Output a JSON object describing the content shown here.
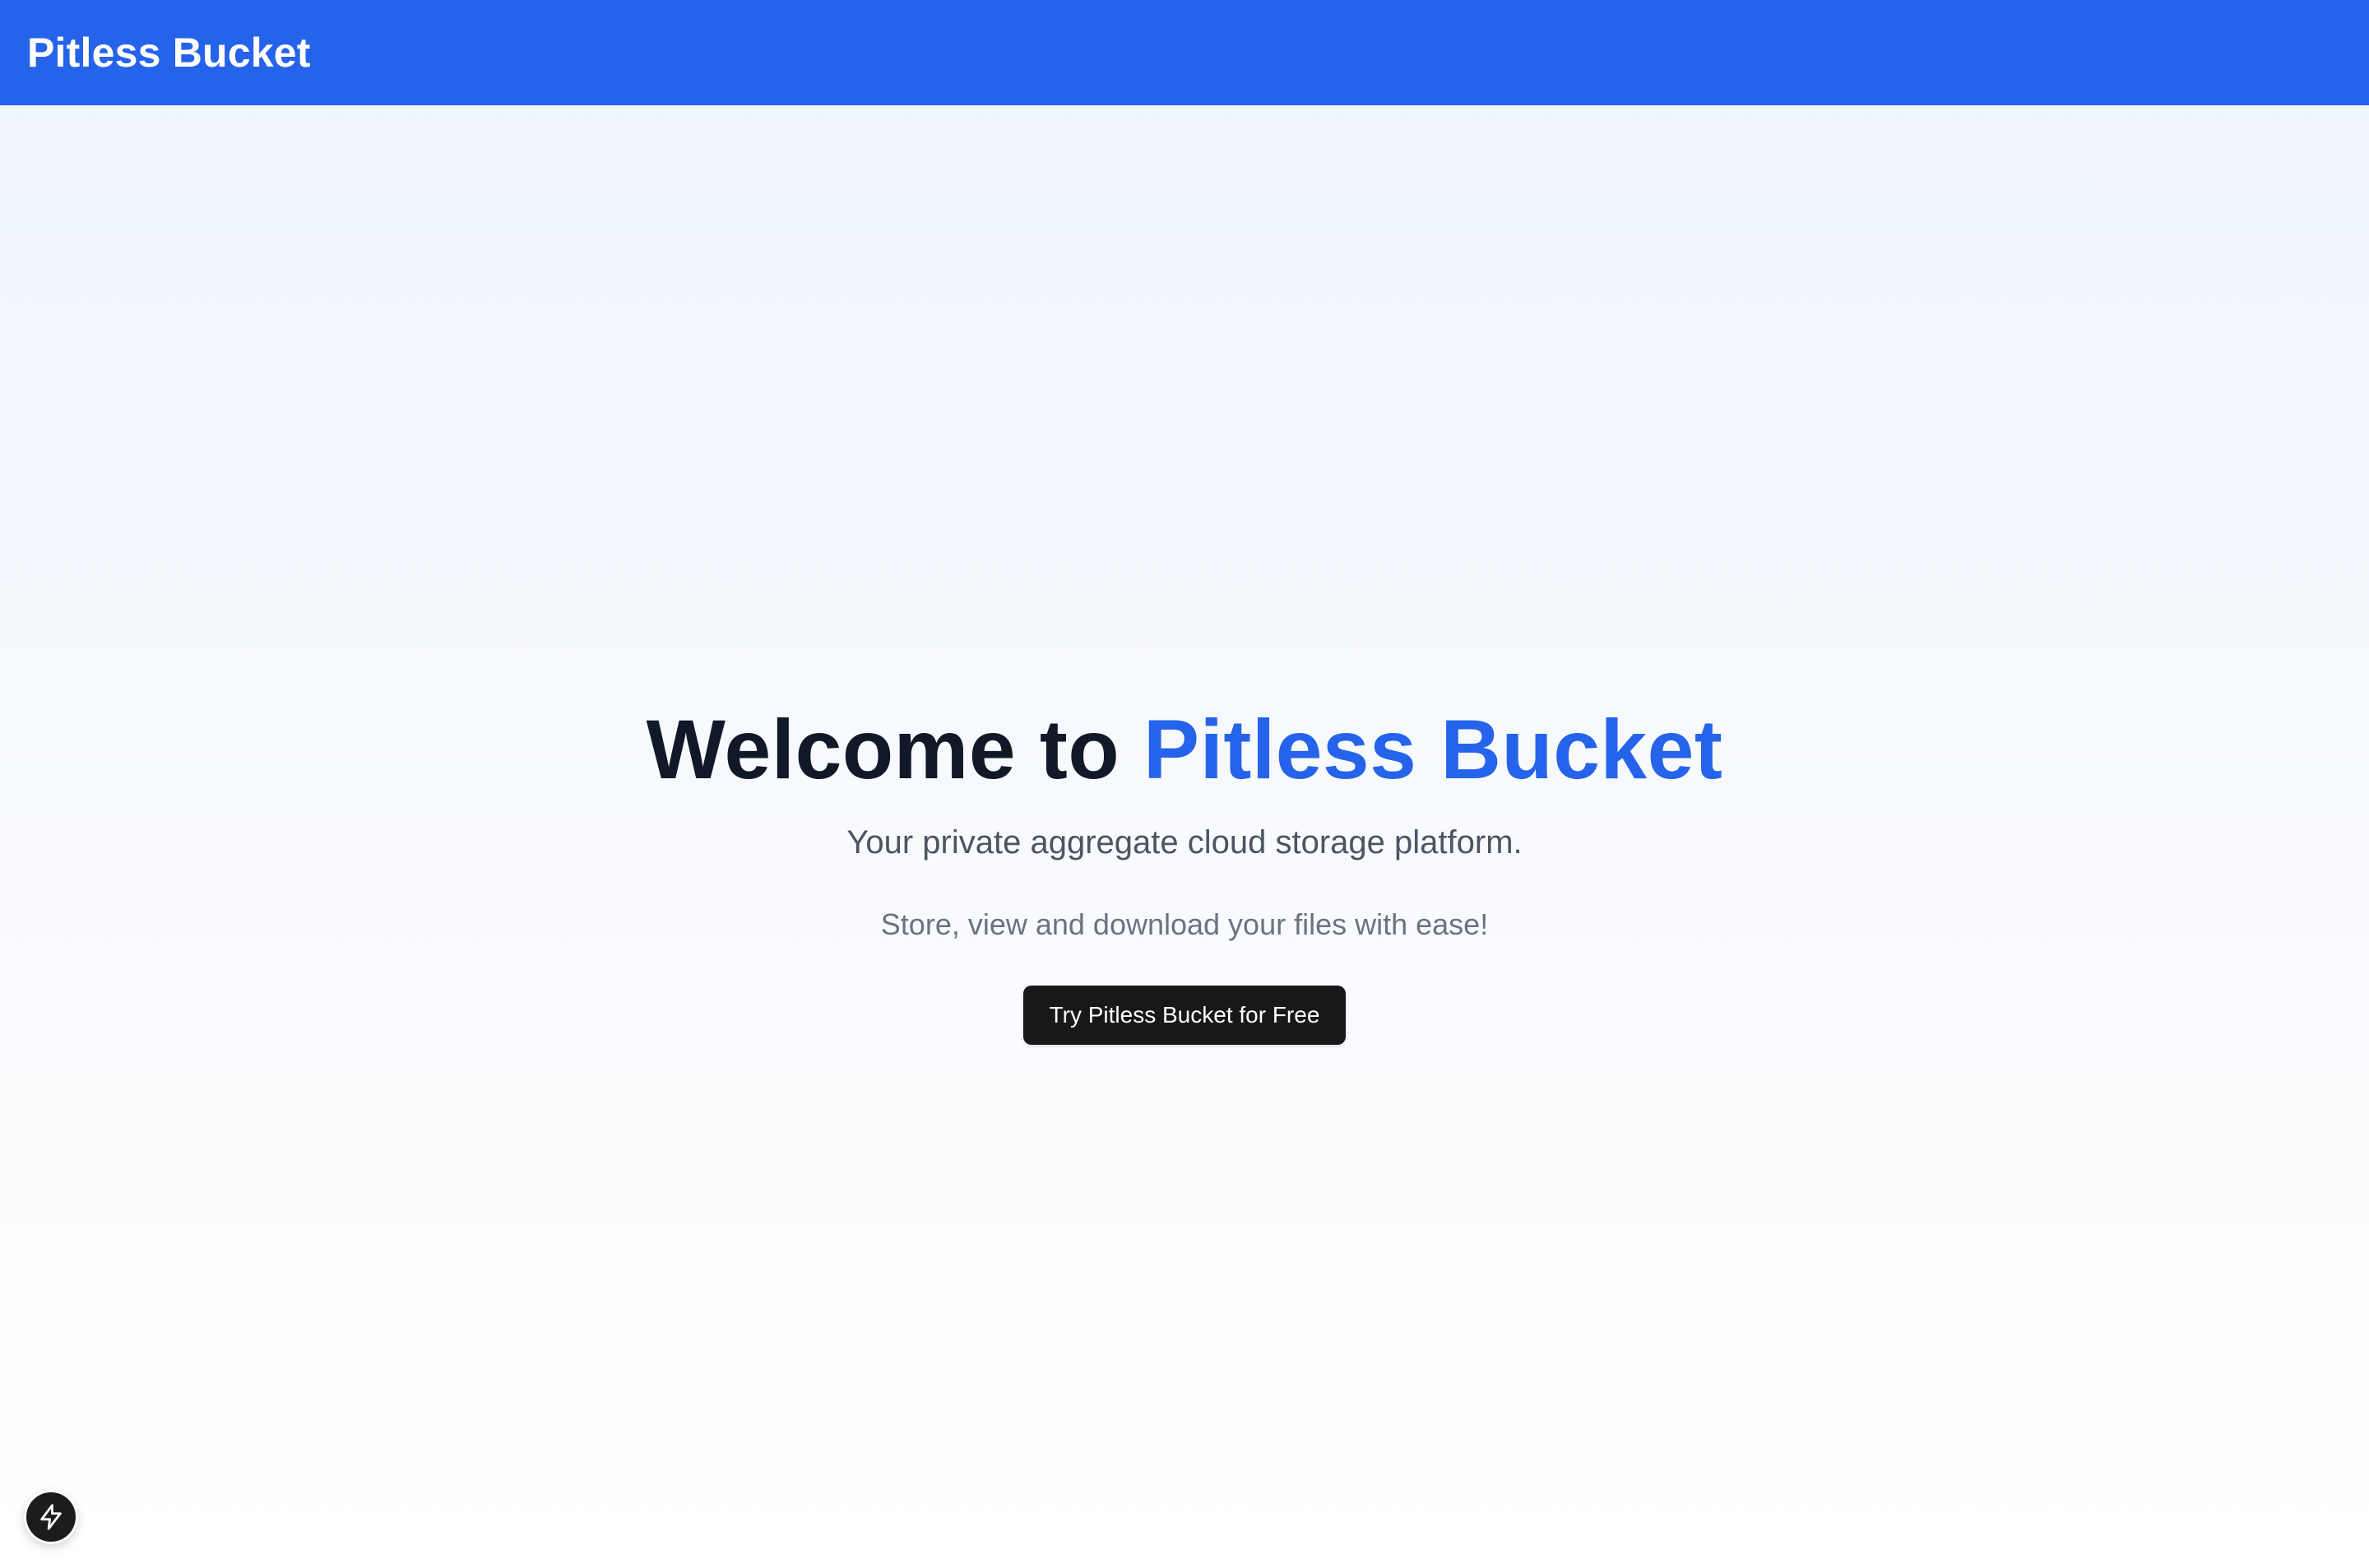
{
  "header": {
    "brand": "Pitless Bucket",
    "background_color": "#2563eb"
  },
  "hero": {
    "title_prefix": "Welcome to",
    "title_highlight": "Pitless Bucket",
    "subtitle": "Your private aggregate cloud storage platform.",
    "tagline": "Store, view and download your files with ease!",
    "cta_label": "Try Pitless Bucket for Free",
    "accent_color": "#2563eb"
  },
  "dev_indicator": {
    "icon": "lightning-bolt-icon"
  }
}
